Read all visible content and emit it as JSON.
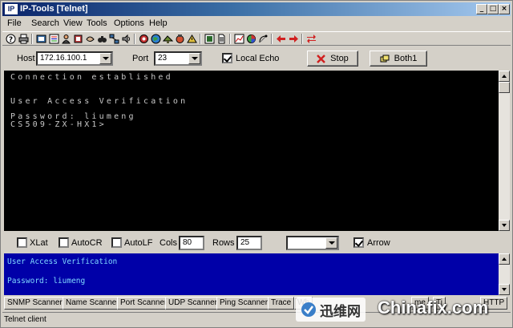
{
  "window": {
    "app_icon": "IP",
    "title": "IP-Tools [Telnet]",
    "buttons": {
      "minimize": "_",
      "maximize": "□",
      "close": "×"
    }
  },
  "menu": [
    "File",
    "Search",
    "View",
    "Tools",
    "Options",
    "Help"
  ],
  "toolbar_icons": [
    "help-icon",
    "print-icon",
    "local-info-icon",
    "connections-icon",
    "users-icon",
    "phonebook-icon",
    "binoculars-icon",
    "finger-icon",
    "speaker-icon",
    "network-icon",
    "globe-icon",
    "mail-icon",
    "ping-icon",
    "trace-icon",
    "monitor-icon",
    "document-icon",
    "chart-icon",
    "record-icon",
    "satellite-icon",
    "arrow-left-icon",
    "arrow-right-icon",
    "swap-icon"
  ],
  "connection": {
    "host_label": "Host",
    "host_value": "172.16.100.1",
    "port_label": "Port",
    "port_value": "23",
    "local_echo_label": "Local Echo",
    "local_echo_checked": true,
    "stop_label": "Stop",
    "both_label": "Both1"
  },
  "terminal": {
    "lines": [
      "Connection established",
      "",
      "User Access Verification",
      "",
      "Password: liumeng",
      "CS509-ZX-HX1>"
    ]
  },
  "options": {
    "xlat_label": "XLat",
    "autocr_label": "AutoCR",
    "autolf_label": "AutoLF",
    "cols_label": "Cols",
    "cols_value": "80",
    "rows_label": "Rows",
    "rows_value": "25",
    "arrow_label": "Arrow",
    "arrow_checked": true
  },
  "log": {
    "lines": [
      "User Access Verification",
      "",
      "Password: liumeng"
    ]
  },
  "tabs": [
    "SNMP Scanner",
    "Name Scanner",
    "Port Scanner",
    "UDP Scanner",
    "Ping Scanner",
    "Trace",
    "Wh",
    "me",
    "Ti",
    "HTTP"
  ],
  "status": {
    "text": "Telnet client"
  },
  "watermark": {
    "cn_text": "迅维网",
    "en_text": "Chinafix.com"
  },
  "colors": {
    "terminal_bg": "#000000",
    "log_bg": "#0000a8",
    "title_bar": "#0a246a"
  }
}
